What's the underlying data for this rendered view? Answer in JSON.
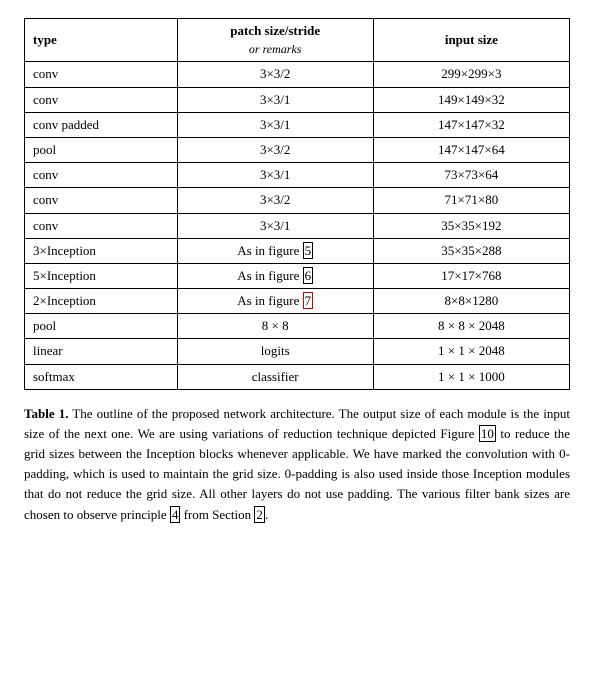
{
  "table": {
    "headers": {
      "col1": "type",
      "col2_main": "patch size/stride",
      "col2_sub": "or remarks",
      "col3": "input size"
    },
    "rows": [
      {
        "type": "conv",
        "patch": "3×3/2",
        "input": "299×299×3"
      },
      {
        "type": "conv",
        "patch": "3×3/1",
        "input": "149×149×32"
      },
      {
        "type": "conv padded",
        "patch": "3×3/1",
        "input": "147×147×32"
      },
      {
        "type": "pool",
        "patch": "3×3/2",
        "input": "147×147×64"
      },
      {
        "type": "conv",
        "patch": "3×3/1",
        "input": "73×73×64"
      },
      {
        "type": "conv",
        "patch": "3×3/2",
        "input": "71×71×80"
      },
      {
        "type": "conv",
        "patch": "3×3/1",
        "input": "35×35×192"
      },
      {
        "type": "3×Inception",
        "patch": "As in figure 5",
        "input": "35×35×288",
        "patch_ref": "5",
        "patch_ref_highlight": false
      },
      {
        "type": "5×Inception",
        "patch": "As in figure 6",
        "input": "17×17×768",
        "patch_ref": "6",
        "patch_ref_highlight": false
      },
      {
        "type": "2×Inception",
        "patch": "As in figure 7",
        "input": "8×8×1280",
        "patch_ref": "7",
        "patch_ref_highlight": true
      },
      {
        "type": "pool",
        "patch": "8 × 8",
        "input": "8 × 8 × 2048"
      },
      {
        "type": "linear",
        "patch": "logits",
        "input": "1 × 1 × 2048"
      },
      {
        "type": "softmax",
        "patch": "classifier",
        "input": "1 × 1 × 1000"
      }
    ]
  },
  "caption": {
    "label": "Table 1.",
    "text": " The outline of the proposed network architecture.  The output size of each module is the input size of the next one.  We are using variations of reduction technique depicted Figure ",
    "ref10": "10",
    "text2": " to reduce the grid sizes between the Inception blocks whenever applicable. We have marked the convolution with 0-padding, which is used to maintain the grid size.  0-padding is also used inside those Inception modules that do not reduce the grid size. All other layers do not use padding. The various filter bank sizes are chosen to observe principle ",
    "ref4": "4",
    "text3": " from Section ",
    "ref2": "2",
    "text4": "."
  }
}
